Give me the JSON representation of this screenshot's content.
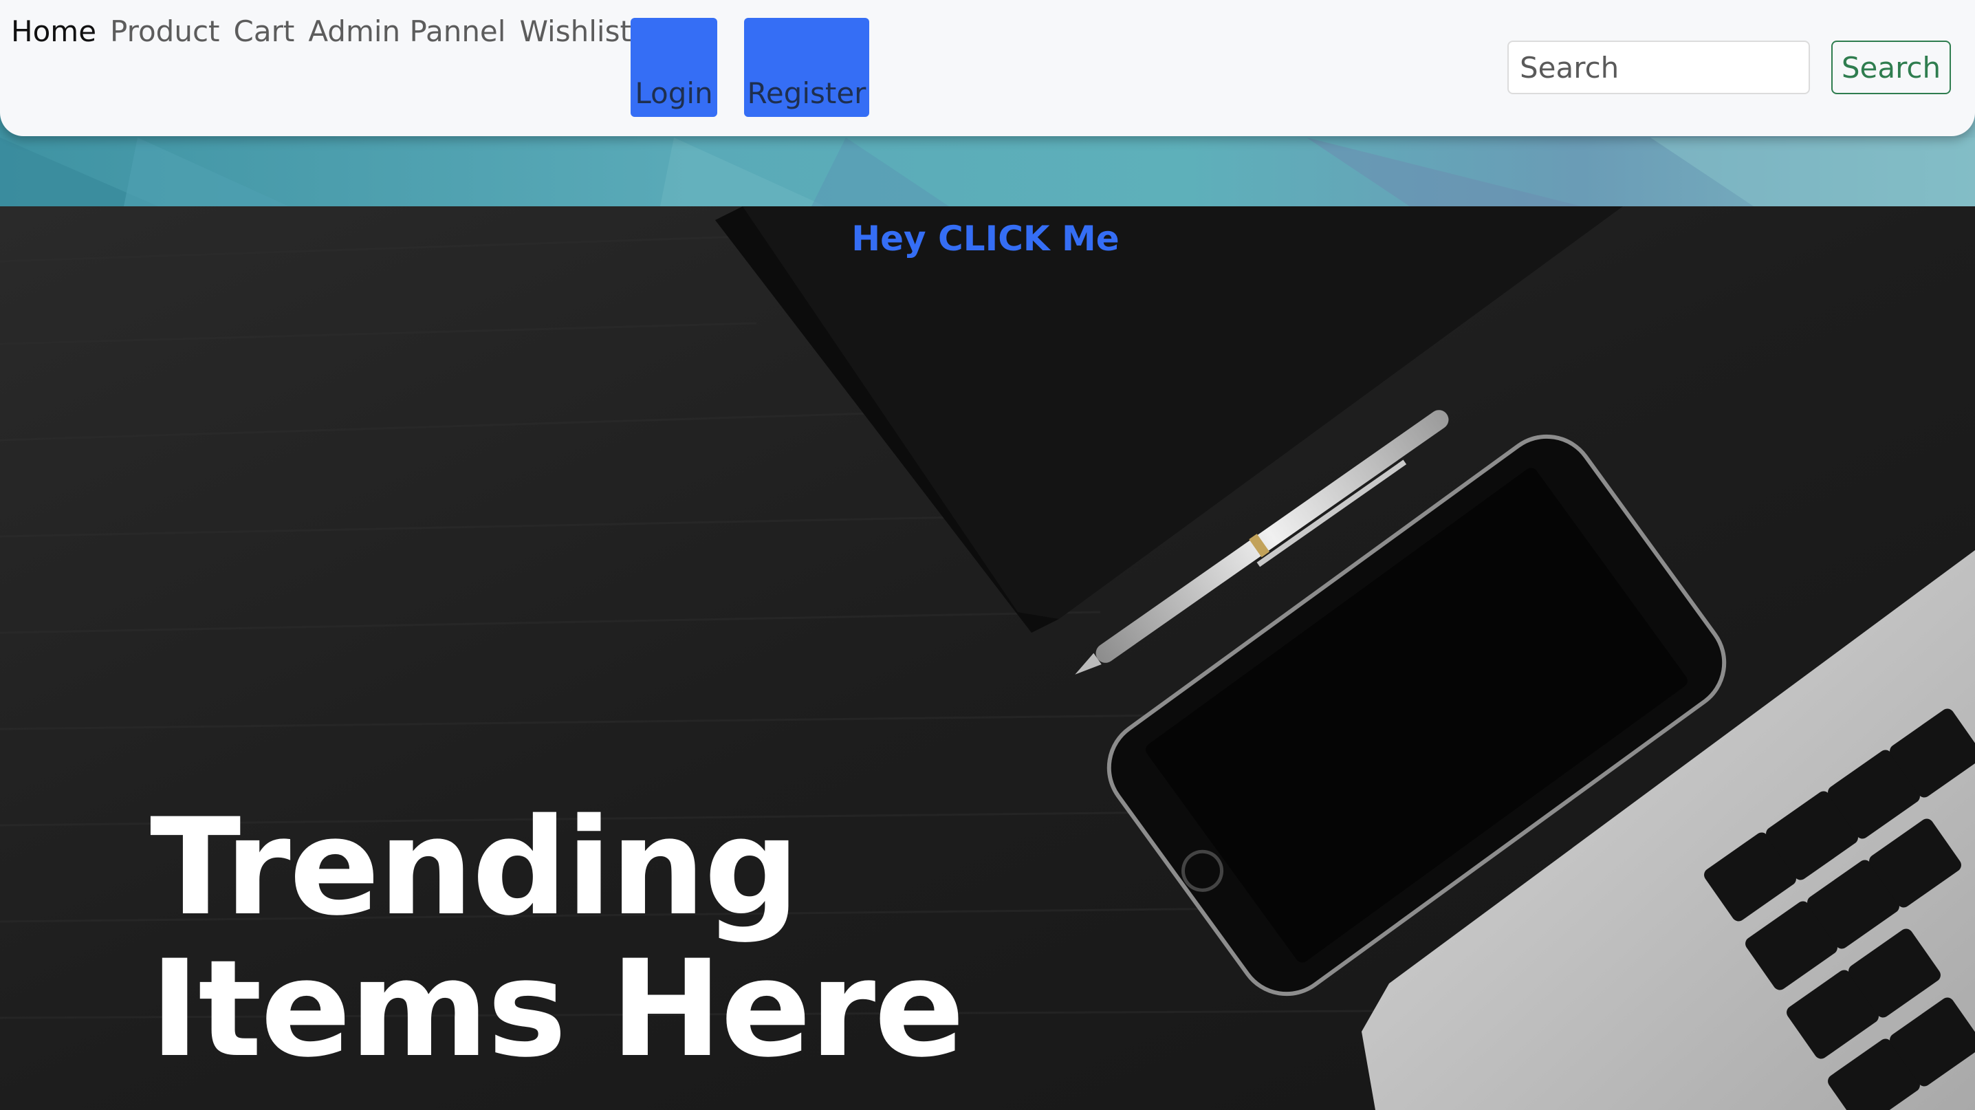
{
  "nav": {
    "links": [
      {
        "label": "Home",
        "active": true
      },
      {
        "label": "Product",
        "active": false
      },
      {
        "label": "Cart",
        "active": false
      },
      {
        "label": "Admin Pannel",
        "active": false
      },
      {
        "label": "Wishlist",
        "active": false
      }
    ],
    "login_label": "Login",
    "register_label": "Register",
    "search": {
      "placeholder": "Search",
      "button_label": "Search"
    }
  },
  "hero": {
    "cta_label": "Hey CLICK Me",
    "title_line1": "Trending",
    "title_line2": "Items Here"
  },
  "colors": {
    "primary": "#356ef5",
    "success": "#2f7d4f",
    "navbar_bg": "#f7f8fa",
    "hero_bg": "#1f1f1f"
  }
}
